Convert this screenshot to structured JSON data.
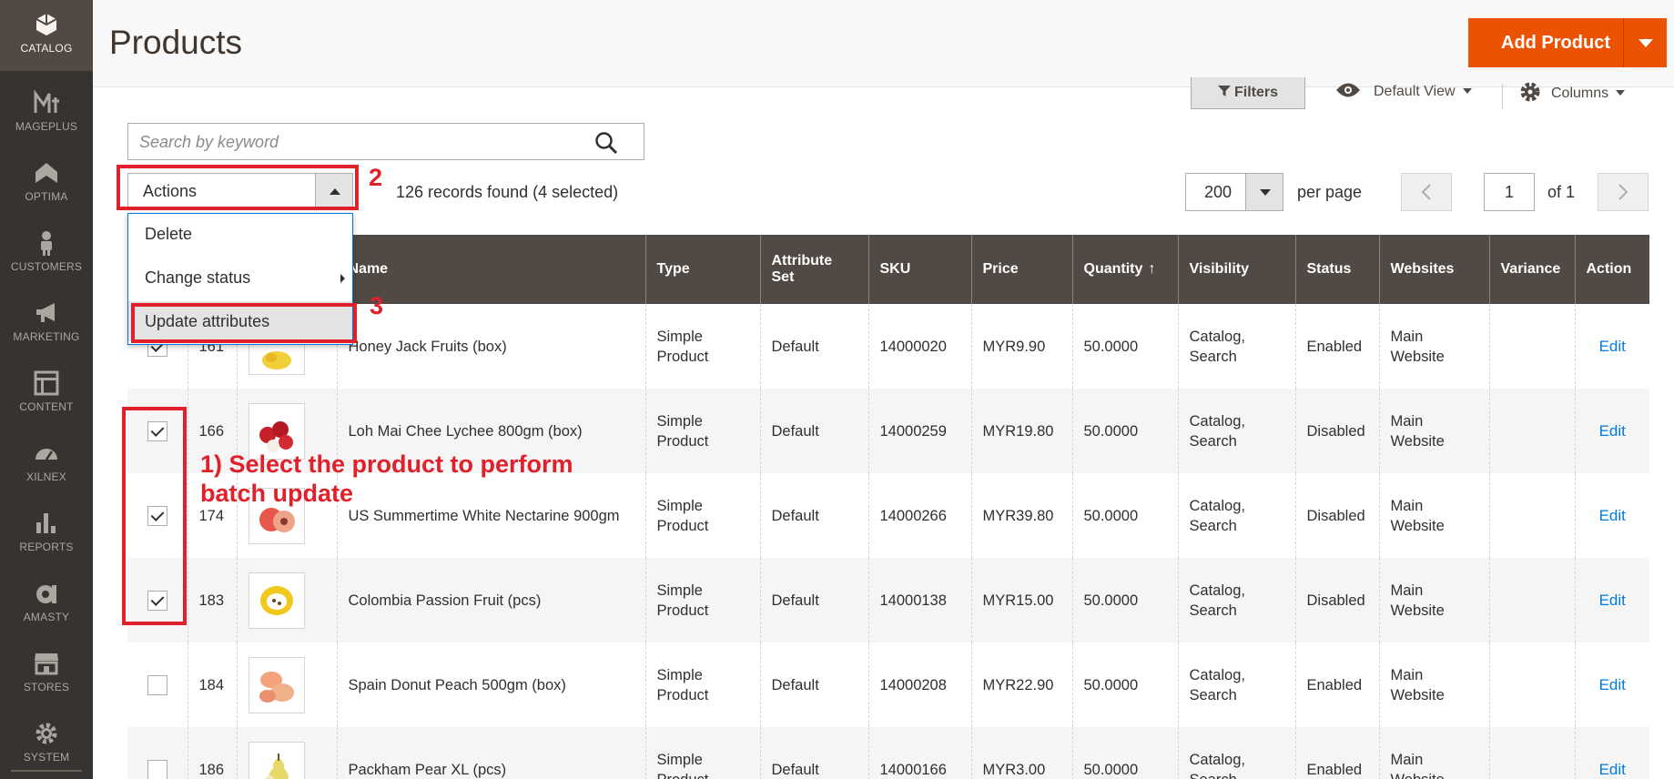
{
  "sidebar": {
    "items": [
      {
        "label": "CATALOG",
        "icon": "catalog-icon",
        "active": true
      },
      {
        "label": "MAGEPLUS",
        "icon": "mageplus-icon"
      },
      {
        "label": "OPTIMA",
        "icon": "optima-icon"
      },
      {
        "label": "CUSTOMERS",
        "icon": "customers-icon"
      },
      {
        "label": "MARKETING",
        "icon": "marketing-icon"
      },
      {
        "label": "CONTENT",
        "icon": "content-icon"
      },
      {
        "label": "XILNEX",
        "icon": "xilnex-icon"
      },
      {
        "label": "REPORTS",
        "icon": "reports-icon"
      },
      {
        "label": "AMASTY",
        "icon": "amasty-icon"
      },
      {
        "label": "STORES",
        "icon": "stores-icon"
      },
      {
        "label": "SYSTEM",
        "icon": "system-icon"
      }
    ]
  },
  "header": {
    "title": "Products",
    "add_button": "Add Product"
  },
  "toolbar": {
    "filters": "Filters",
    "view": "Default View",
    "columns": "Columns",
    "search_placeholder": "Search by keyword",
    "actions": "Actions",
    "records": "126 records found (4 selected)",
    "per_page_value": "200",
    "per_page_label": "per page",
    "page_value": "1",
    "page_of": "of 1"
  },
  "actions_menu": {
    "items": [
      "Delete",
      "Change status",
      "Update attributes"
    ]
  },
  "grid": {
    "headers": [
      "",
      "",
      "",
      "Name",
      "Type",
      "Attribute Set",
      "SKU",
      "Price",
      "Quantity",
      "Visibility",
      "Status",
      "Websites",
      "Variance",
      "Action"
    ],
    "sort_arrow": "↑",
    "rows": [
      {
        "checked": true,
        "id": "161",
        "name": "Honey Jack Fruits (box)",
        "type": "Simple Product",
        "set": "Default",
        "sku": "14000020",
        "price": "MYR9.90",
        "qty": "50.0000",
        "visibility": "Catalog, Search",
        "status": "Enabled",
        "websites": "Main Website",
        "action": "Edit"
      },
      {
        "checked": true,
        "id": "166",
        "name": "Loh Mai Chee Lychee 800gm (box)",
        "type": "Simple Product",
        "set": "Default",
        "sku": "14000259",
        "price": "MYR19.80",
        "qty": "50.0000",
        "visibility": "Catalog, Search",
        "status": "Disabled",
        "websites": "Main Website",
        "action": "Edit"
      },
      {
        "checked": true,
        "id": "174",
        "name": "US Summertime White Nectarine 900gm",
        "type": "Simple Product",
        "set": "Default",
        "sku": "14000266",
        "price": "MYR39.80",
        "qty": "50.0000",
        "visibility": "Catalog, Search",
        "status": "Disabled",
        "websites": "Main Website",
        "action": "Edit"
      },
      {
        "checked": true,
        "id": "183",
        "name": "Colombia Passion Fruit (pcs)",
        "type": "Simple Product",
        "set": "Default",
        "sku": "14000138",
        "price": "MYR15.00",
        "qty": "50.0000",
        "visibility": "Catalog, Search",
        "status": "Disabled",
        "websites": "Main Website",
        "action": "Edit"
      },
      {
        "checked": false,
        "id": "184",
        "name": "Spain Donut Peach 500gm (box)",
        "type": "Simple Product",
        "set": "Default",
        "sku": "14000208",
        "price": "MYR22.90",
        "qty": "50.0000",
        "visibility": "Catalog, Search",
        "status": "Enabled",
        "websites": "Main Website",
        "action": "Edit"
      },
      {
        "checked": false,
        "id": "186",
        "name": "Packham Pear XL (pcs)",
        "type": "Simple Product",
        "set": "Default",
        "sku": "14000166",
        "price": "MYR3.00",
        "qty": "50.0000",
        "visibility": "Catalog, Search",
        "status": "Enabled",
        "websites": "Main Website",
        "action": "Edit"
      }
    ]
  },
  "annotations": {
    "step1": "1) Select the product to perform batch update",
    "step2": "2",
    "step3": "3",
    "color": "#e0202b"
  },
  "colors": {
    "sidebar": "#373330",
    "accent": "#eb5202",
    "grid_header": "#514943",
    "link": "#007bdb"
  }
}
